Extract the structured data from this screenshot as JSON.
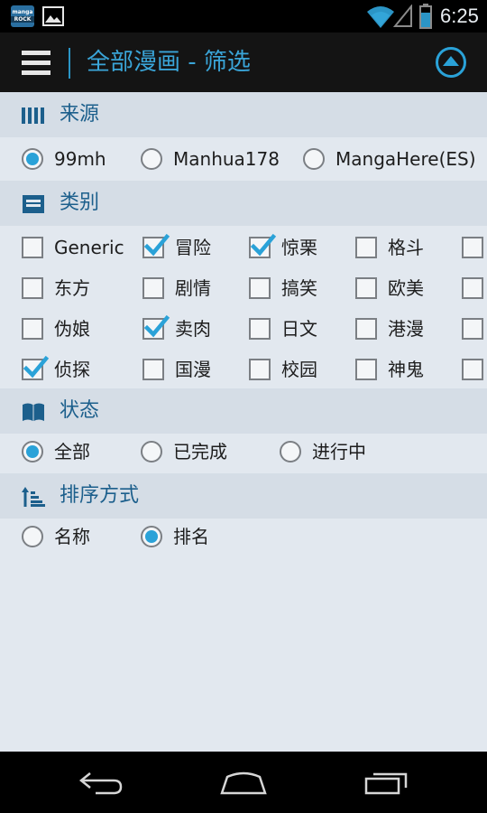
{
  "status_bar": {
    "time": "6:25",
    "app_icon_lines": [
      "manga",
      "ROCK"
    ]
  },
  "action_bar": {
    "title": "全部漫画 - 筛选",
    "menu_icon": "hamburger-menu-icon",
    "up_icon": "circle-up-arrow-icon"
  },
  "sections": {
    "source": {
      "title": "来源",
      "icon": "columns-icon",
      "options": [
        {
          "label": "99mh",
          "checked": true
        },
        {
          "label": "Manhua178",
          "checked": false
        },
        {
          "label": "MangaHere(ES)",
          "checked": false
        }
      ]
    },
    "category": {
      "title": "类别",
      "icon": "tray-icon",
      "rows": [
        [
          {
            "label": "Generic",
            "checked": false
          },
          {
            "label": "冒险",
            "checked": true
          },
          {
            "label": "惊栗",
            "checked": true
          },
          {
            "label": "格斗",
            "checked": false
          },
          {
            "label": "",
            "checked": false
          }
        ],
        [
          {
            "label": "东方",
            "checked": false
          },
          {
            "label": "剧情",
            "checked": false
          },
          {
            "label": "搞笑",
            "checked": false
          },
          {
            "label": "欧美",
            "checked": false
          },
          {
            "label": "",
            "checked": false
          }
        ],
        [
          {
            "label": "伪娘",
            "checked": false
          },
          {
            "label": "卖肉",
            "checked": true
          },
          {
            "label": "日文",
            "checked": false
          },
          {
            "label": "港漫",
            "checked": false
          },
          {
            "label": "",
            "checked": false
          }
        ],
        [
          {
            "label": "侦探",
            "checked": true
          },
          {
            "label": "国漫",
            "checked": false
          },
          {
            "label": "校园",
            "checked": false
          },
          {
            "label": "神鬼",
            "checked": false
          },
          {
            "label": "",
            "checked": false
          }
        ]
      ]
    },
    "status": {
      "title": "状态",
      "icon": "open-book-icon",
      "options": [
        {
          "label": "全部",
          "checked": true
        },
        {
          "label": "已完成",
          "checked": false
        },
        {
          "label": "进行中",
          "checked": false
        }
      ]
    },
    "sort": {
      "title": "排序方式",
      "icon": "sort-ascending-icon",
      "options": [
        {
          "label": "名称",
          "checked": false
        },
        {
          "label": "排名",
          "checked": true
        }
      ]
    }
  },
  "colors": {
    "accent": "#2aa2d8",
    "title_blue": "#3aa5d8",
    "section_text": "#1c5f8c",
    "section_bg": "#d5dde6",
    "content_bg": "#e2e8ef"
  }
}
